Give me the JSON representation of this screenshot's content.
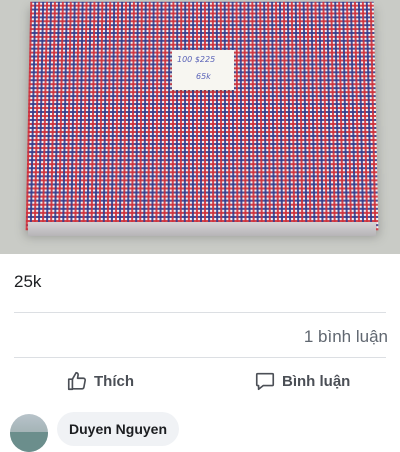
{
  "post": {
    "price_text": "25k",
    "tag": {
      "line1": "100 $225",
      "line2": "65k"
    }
  },
  "stats": {
    "comment_count_text": "1 bình luận"
  },
  "actions": {
    "like_label": "Thích",
    "comment_label": "Bình luận"
  },
  "comments": [
    {
      "author": "Duyen Nguyen"
    }
  ],
  "colors": {
    "text_dark": "#1c1e21",
    "text_muted": "#606770",
    "action_text": "#4b4f56",
    "bubble_bg": "#f0f2f5"
  }
}
